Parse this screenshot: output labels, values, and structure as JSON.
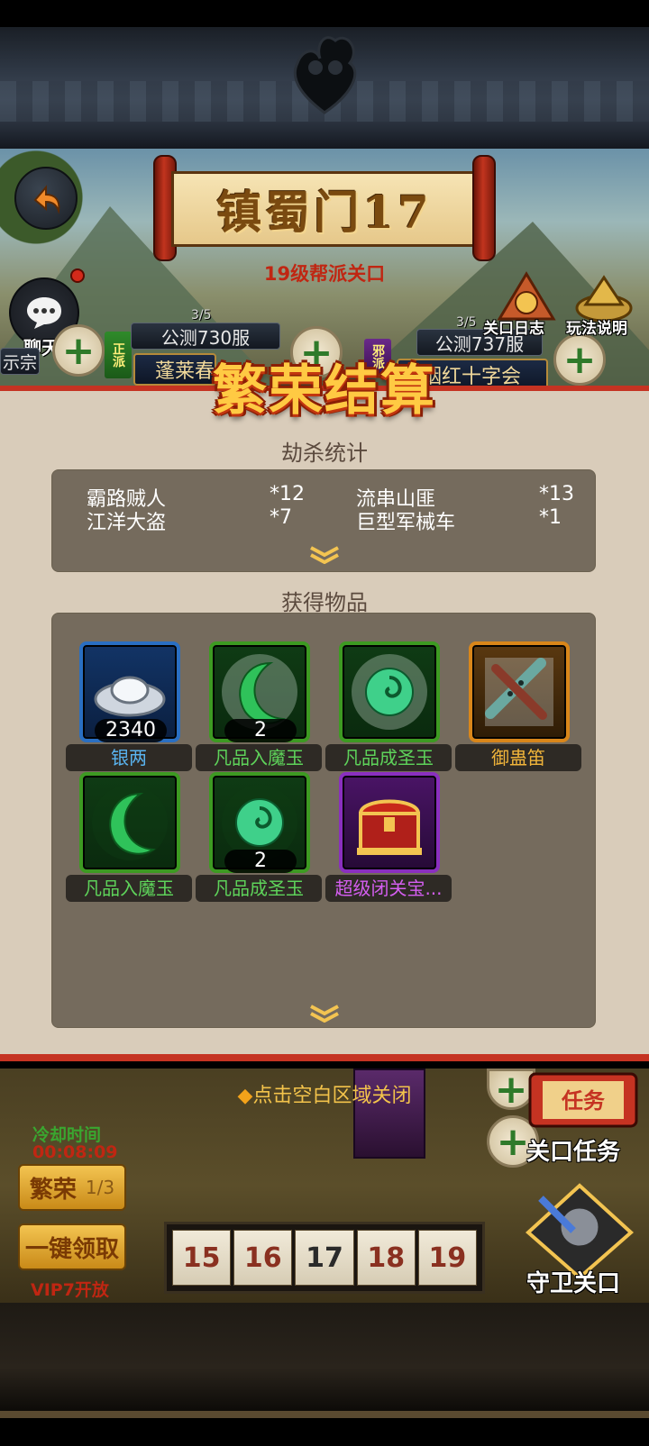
{
  "scene": {
    "stage_title": "镇蜀门17",
    "stage_subtitle": "19级帮派关口",
    "chat_label": "聊天",
    "left_server": {
      "count": "3/5",
      "name": "公测730服",
      "faction": "蓬莱春",
      "side": "正派"
    },
    "right_server": {
      "count": "3/5",
      "name": "公测737服",
      "faction": "烟红十字会",
      "side": "邪派"
    },
    "left_edge_text": "示宗",
    "log_button": "关口日志",
    "rules_button": "玩法说明"
  },
  "modal": {
    "title": "繁荣结算",
    "kill_section_title": "劫杀统计",
    "kills": [
      {
        "name": "霸路贼人",
        "count": "*12"
      },
      {
        "name": "流串山匪",
        "count": "*13"
      },
      {
        "name": "江洋大盗",
        "count": "*7"
      },
      {
        "name": "巨型军械车",
        "count": "*1"
      }
    ],
    "items_section_title": "获得物品",
    "items": [
      {
        "name": "银两",
        "count": "2340",
        "rarity": "blue",
        "icon": "silver-ingot-icon",
        "name_color": "#5ab4f0"
      },
      {
        "name": "凡品入魔玉",
        "count": "2",
        "rarity": "green",
        "icon": "crescent-jade-icon",
        "name_color": "#5ed35a"
      },
      {
        "name": "凡品成圣玉",
        "count": "",
        "rarity": "green",
        "icon": "swirl-jade-icon",
        "name_color": "#5ed35a"
      },
      {
        "name": "御蛊笛",
        "count": "",
        "rarity": "orange",
        "icon": "flute-icon",
        "name_color": "#f0b43a"
      },
      {
        "name": "凡品入魔玉",
        "count": "",
        "rarity": "green",
        "icon": "crescent-jade-icon",
        "name_color": "#5ed35a"
      },
      {
        "name": "凡品成圣玉",
        "count": "2",
        "rarity": "green",
        "icon": "swirl-jade-icon",
        "name_color": "#5ed35a"
      },
      {
        "name": "超级闭关宝...",
        "count": "",
        "rarity": "purple",
        "icon": "treasure-chest-icon",
        "name_color": "#d45ef0"
      }
    ]
  },
  "close_hint": "点击空白区域关闭",
  "bottom": {
    "cooldown_label": "冷却时间",
    "cooldown_time": "00:08:09",
    "prosperity_label": "繁荣",
    "prosperity_count": "1/3",
    "claim_all_label": "一键领取",
    "vip_unlock": "VIP7开放",
    "levels": [
      "15",
      "16",
      "17",
      "18",
      "19"
    ],
    "current_level": "17",
    "task_button": "关口任务",
    "guard_button": "守卫关口",
    "task_badge": "任务"
  },
  "colors": {
    "accent_red": "#c53322",
    "modal_bg": "#d9ccba",
    "panel_bg": "#756b5d",
    "title_gold": "#ffca43"
  }
}
